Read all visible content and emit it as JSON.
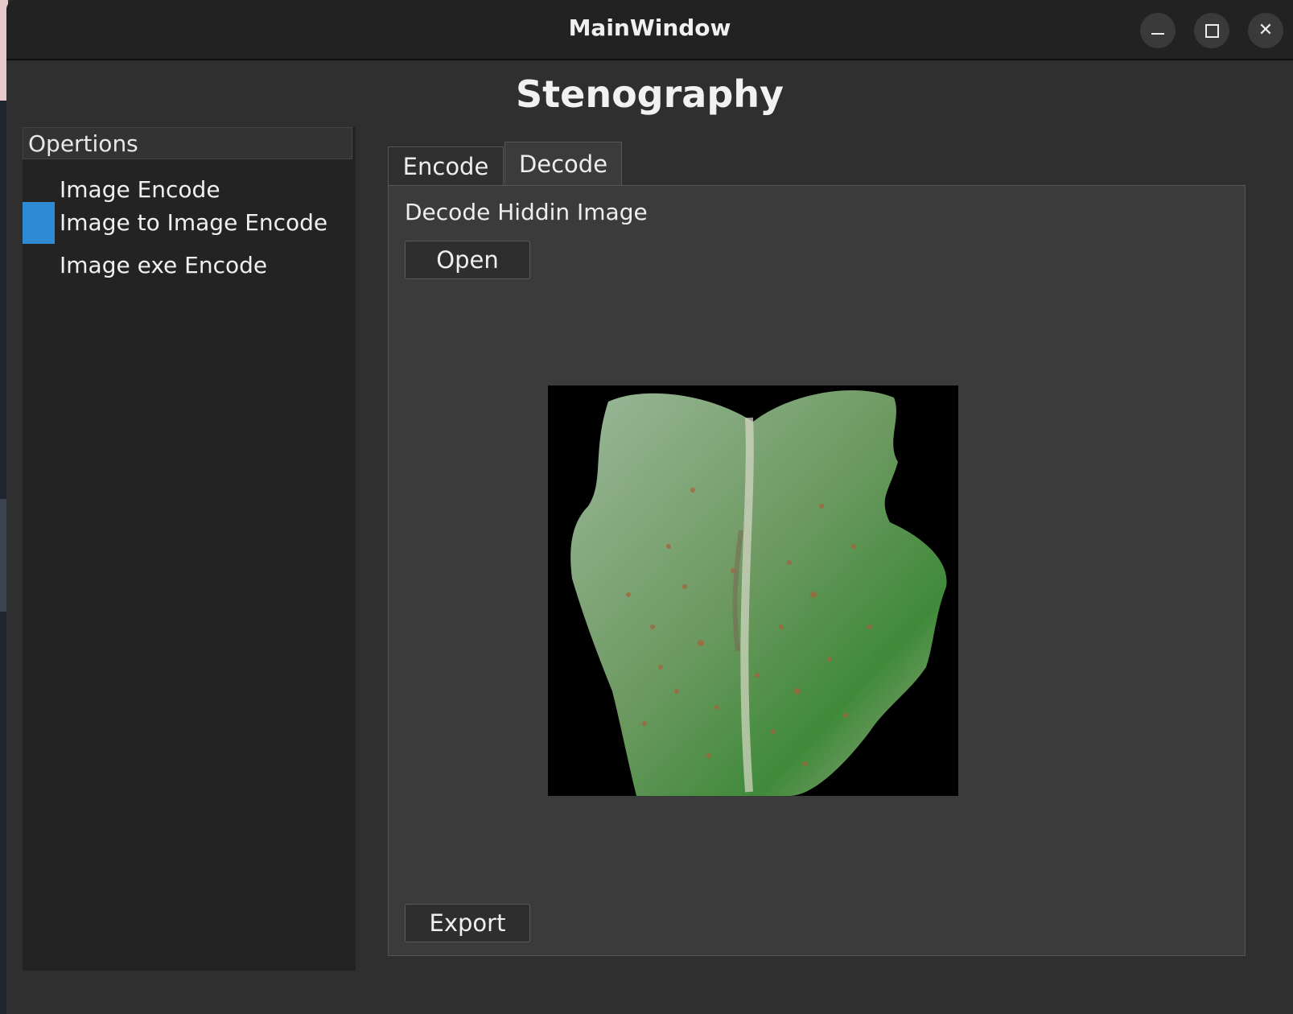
{
  "window": {
    "title": "MainWindow"
  },
  "app": {
    "heading": "Stenography"
  },
  "sidebar": {
    "header": "Opertions",
    "items": [
      {
        "label": "Image Encode",
        "selected": false
      },
      {
        "label": "Image to Image Encode",
        "selected": true
      },
      {
        "label": "Image exe Encode",
        "selected": false
      }
    ]
  },
  "tabs": [
    {
      "label": "Encode",
      "active": false
    },
    {
      "label": "Decode",
      "active": true
    }
  ],
  "decode_panel": {
    "label": "Decode Hiddin Image",
    "open_label": "Open",
    "export_label": "Export"
  },
  "colors": {
    "selection": "#2e8bd3",
    "leaf_green": "#4f8a4f",
    "background": "#2f2f2f"
  }
}
